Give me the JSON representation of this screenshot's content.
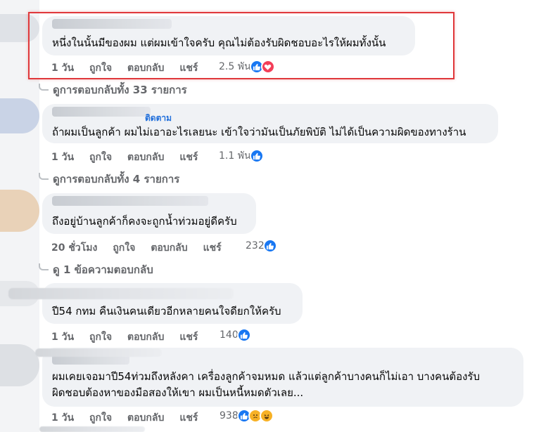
{
  "comments": [
    {
      "text": "หนึ่งในนั้นมีของผม แต่ผมเข้าใจครับ คุณไม่ต้องรับผิดชอบอะไรให้ผมทั้งนั้น",
      "time": "1 วัน",
      "like": "ถูกใจ",
      "reply": "ตอบกลับ",
      "share": "แชร์",
      "reaction_count": "2.5 พัน",
      "reactions": [
        "like",
        "love"
      ],
      "view_replies": "ดูการตอบกลับทั้ง 33 รายการ"
    },
    {
      "follow_label": "ติดตาม",
      "text": "ถ้าผมเป็นลูกค้า ผมไม่เอาอะไรเลยนะ เข้าใจว่ามันเป็นภัยพิบัติ ไม่ได้เป็นความผิดของทางร้าน",
      "time": "1 วัน",
      "like": "ถูกใจ",
      "reply": "ตอบกลับ",
      "share": "แชร์",
      "reaction_count": "1.1 พัน",
      "reactions": [
        "like"
      ],
      "view_replies": "ดูการตอบกลับทั้ง 4 รายการ"
    },
    {
      "text": "ถึงอยู่บ้านลูกค้าก็คงจะถูกน้ำท่วมอยู่ดีครับ",
      "time": "20 ชั่วโมง",
      "like": "ถูกใจ",
      "reply": "ตอบกลับ",
      "share": "แชร์",
      "reaction_count": "232",
      "reactions": [
        "like"
      ],
      "view_replies": "ดู 1 ข้อความตอบกลับ"
    },
    {
      "text": "ปี54 กทม คืนเงินคนเดียวอีกหลายคนใจดียกให้ครับ",
      "time": "1 วัน",
      "like": "ถูกใจ",
      "reply": "ตอบกลับ",
      "share": "แชร์",
      "reaction_count": "140",
      "reactions": [
        "like"
      ]
    },
    {
      "text_line1": "ผมเคยเจอมาปี54ท่วมถึงหลังคา เครื่องลูกค้าจมหมด แล้วแต่ลูกค้าบางคนก็ไม่เอา บางคนต้องรับ",
      "text_line2": "ผิดชอบต้องหาของมือสองให้เขา ผมเป็นหนี้หมดตัวเลย...",
      "time": "1 วัน",
      "like": "ถูกใจ",
      "reply": "ตอบกลับ",
      "share": "แชร์",
      "reaction_count": "938",
      "reactions": [
        "like",
        "haha",
        "haha"
      ]
    }
  ],
  "colors": {
    "bubble": "#f0f2f5",
    "secondary_text": "#65676b",
    "link": "#216fdb",
    "highlight": "#e0383b",
    "like": "#1877f2",
    "love": "#f33e58"
  }
}
